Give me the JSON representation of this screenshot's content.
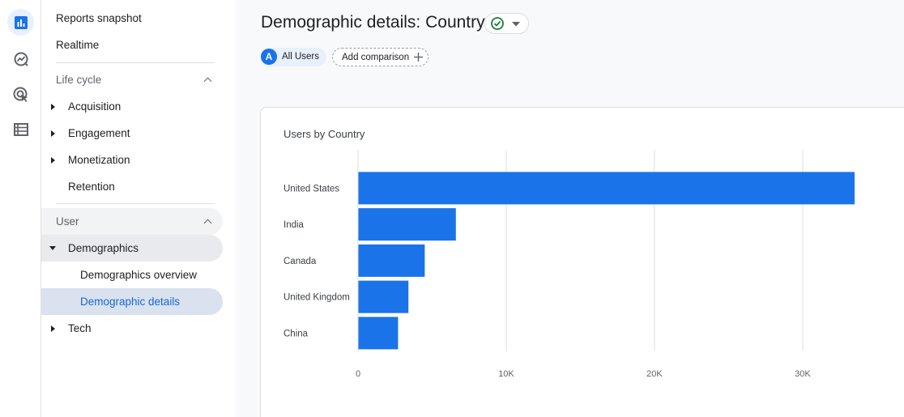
{
  "rail": {
    "items": [
      {
        "icon": "bar-chart-icon",
        "active": true
      },
      {
        "icon": "explore-icon",
        "active": false
      },
      {
        "icon": "advertising-icon",
        "active": false
      },
      {
        "icon": "table-icon",
        "active": false
      }
    ]
  },
  "nav": {
    "reports_snapshot": "Reports snapshot",
    "realtime": "Realtime",
    "lifecycle_header": "Life cycle",
    "acquisition": "Acquisition",
    "engagement": "Engagement",
    "monetization": "Monetization",
    "retention": "Retention",
    "user_header": "User",
    "demographics": "Demographics",
    "demographics_overview": "Demographics overview",
    "demographic_details": "Demographic details",
    "tech": "Tech"
  },
  "header": {
    "title": "Demographic details: Country"
  },
  "segments": {
    "badge": "A",
    "all_users": "All Users",
    "add_comparison": "Add comparison"
  },
  "colors": {
    "accent": "#1a73e8",
    "bar": "#1a73e8",
    "selected_bg": "#d9e2ee",
    "check": "#188038"
  },
  "chart_data": {
    "type": "bar",
    "orientation": "horizontal",
    "title": "Users by Country",
    "categories": [
      "United States",
      "India",
      "Canada",
      "United Kingdom",
      "China"
    ],
    "values": [
      33500,
      6600,
      4500,
      3400,
      2700
    ],
    "xlim": [
      0,
      33500
    ],
    "xticks": [
      0,
      10000,
      20000,
      30000
    ],
    "xtick_labels": [
      "0",
      "10K",
      "20K",
      "30K"
    ],
    "grid": true,
    "xlabel": "",
    "ylabel": ""
  }
}
